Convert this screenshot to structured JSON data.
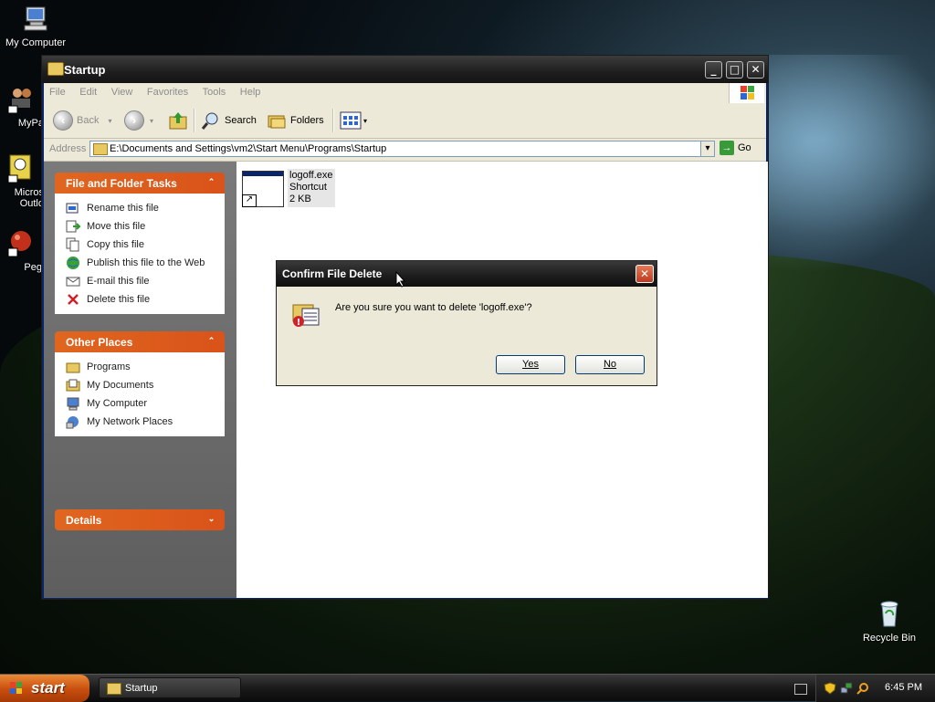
{
  "desktop": {
    "icons": [
      {
        "label": "My Computer"
      },
      {
        "label": "MyPa"
      },
      {
        "label": "Micros"
      },
      {
        "label": "Outlo"
      },
      {
        "label": "Peg"
      },
      {
        "label": "Recycle Bin"
      }
    ]
  },
  "window": {
    "title": "Startup",
    "menu": [
      "File",
      "Edit",
      "View",
      "Favorites",
      "Tools",
      "Help"
    ],
    "toolbar": {
      "back": "Back",
      "search": "Search",
      "folders": "Folders"
    },
    "address": {
      "label": "Address",
      "value": "E:\\Documents and Settings\\vm2\\Start Menu\\Programs\\Startup",
      "go": "Go"
    },
    "panels": {
      "tasks": {
        "title": "File and Folder Tasks",
        "items": [
          "Rename this file",
          "Move this file",
          "Copy this file",
          "Publish this file to the Web",
          "E-mail this file",
          "Delete this file"
        ]
      },
      "places": {
        "title": "Other Places",
        "items": [
          "Programs",
          "My Documents",
          "My Computer",
          "My Network Places"
        ]
      },
      "details": {
        "title": "Details"
      }
    },
    "files": [
      {
        "name": "logoff.exe",
        "type": "Shortcut",
        "size": "2 KB"
      }
    ]
  },
  "dialog": {
    "title": "Confirm File Delete",
    "message": "Are you sure you want to delete 'logoff.exe'?",
    "yes_label": "Yes",
    "no_label": "No"
  },
  "taskbar": {
    "start_label": "start",
    "task_label": "Startup",
    "clock": "6:45 PM"
  }
}
